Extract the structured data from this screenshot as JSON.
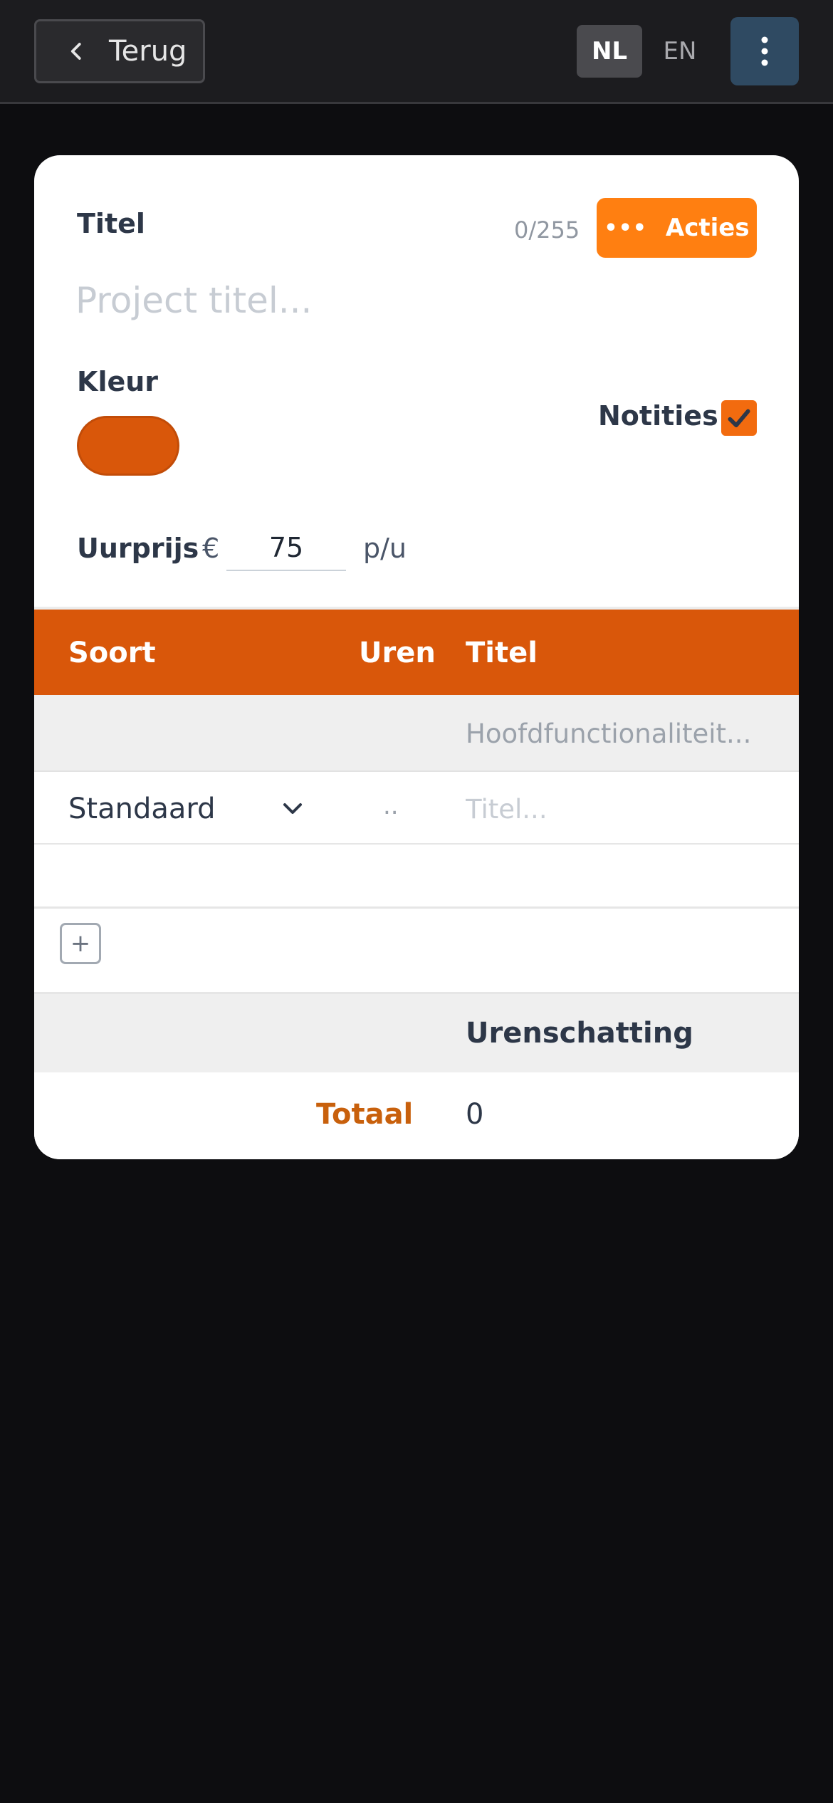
{
  "topbar": {
    "back_label": "Terug",
    "lang_nl": "NL",
    "lang_en": "EN"
  },
  "form": {
    "title_label": "Titel",
    "char_count": "0/255",
    "actions_label": "Acties",
    "title_placeholder": "Project titel...",
    "color_label": "Kleur",
    "color_value": "#d9570a",
    "notes_label": "Notities",
    "notes_checked": true,
    "rate_label": "Uurprijs",
    "currency": "€",
    "rate_value": "75",
    "rate_unit": "p/u"
  },
  "table": {
    "headers": {
      "soort": "Soort",
      "uren": "Uren",
      "titel": "Titel"
    },
    "main_row": {
      "title_placeholder": "Hoofdfunctionaliteit..."
    },
    "sub_row": {
      "type": "Standaard",
      "hours": "..",
      "title_placeholder": "Titel..."
    },
    "add_label": "+",
    "summary_header": "Urenschatting",
    "total_label": "Totaal",
    "total_value": "0"
  },
  "colors": {
    "accent_orange": "#ff7f11",
    "table_header": "#d9570a",
    "menu_button": "#2f4a62"
  },
  "icons": {
    "back": "chevron-left-icon",
    "menu": "kebab-menu-icon",
    "actions": "dots-horizontal-icon",
    "select": "chevron-down-icon",
    "checkbox": "checkmark-icon"
  }
}
